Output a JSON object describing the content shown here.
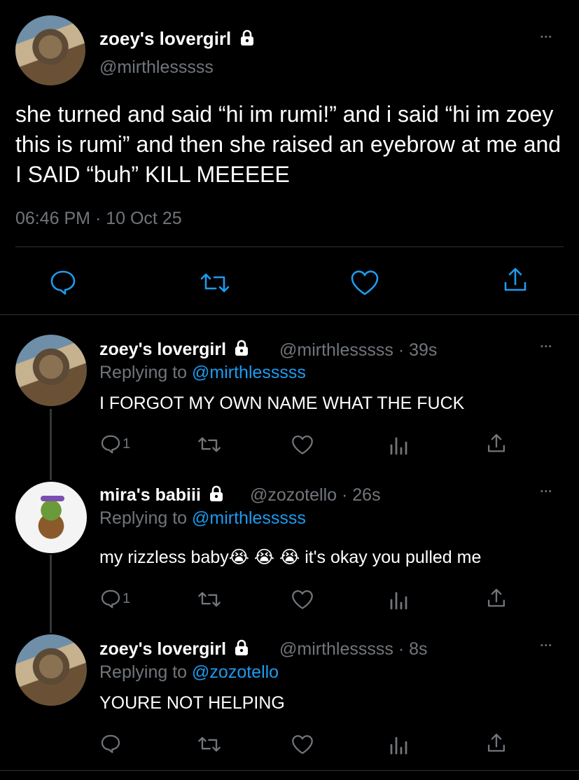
{
  "main_tweet": {
    "display_name": "zoey's lovergirl",
    "handle": "@mirthlesssss",
    "text": "she turned and said “hi im rumi!” and i said “hi im zoey this is rumi”  and then she raised an eyebrow at me and I SAID “buh” KILL MEEEEE",
    "timestamp": "06:46 PM · 10 Oct 25",
    "more": "•••",
    "actions": [
      "reply-icon",
      "retweet-icon",
      "like-icon",
      "share-icon"
    ]
  },
  "replies": [
    {
      "display_name": "zoey's lovergirl",
      "handle_time": "@mirthlesssss · 39s",
      "replying_prefix": "Replying to ",
      "replying_to": "@mirthlesssss",
      "text": "I FORGOT MY OWN NAME WHAT THE FUCK",
      "reply_count": "1",
      "more": "•••"
    },
    {
      "display_name": "mira's babiii",
      "handle_time": "@zozotello · 26s",
      "replying_prefix": "Replying to ",
      "replying_to": "@mirthlesssss",
      "text": "my rizzless baby😭 😭 😭  it's okay you pulled me",
      "reply_count": "1",
      "more": "•••"
    },
    {
      "display_name": "zoey's lovergirl",
      "handle_time": "@mirthlesssss · 8s",
      "replying_prefix": "Replying to ",
      "replying_to": "@zozotello",
      "text": "YOURE NOT HELPING",
      "reply_count": "",
      "more": "•••"
    }
  ],
  "colors": {
    "background": "#000000",
    "text": "#ffffff",
    "secondary": "#71767b",
    "link": "#1d9bf0",
    "divider": "#2f3336"
  }
}
